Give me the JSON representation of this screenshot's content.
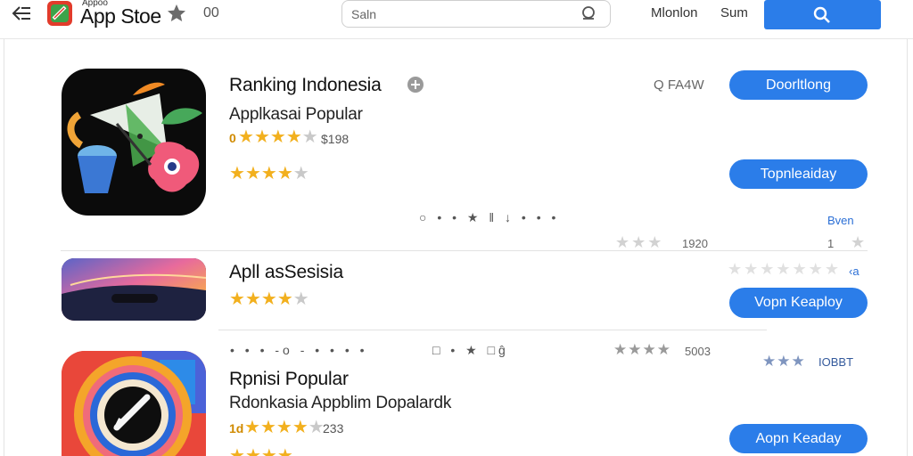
{
  "header": {
    "brand_small": "Appoo",
    "brand": "App Stoe",
    "count": "00",
    "search_placeholder": "Saln",
    "nav_links": [
      "Mlonlon",
      "Sum"
    ]
  },
  "apps": [
    {
      "title": "Ranking Indonesia",
      "subtitle": "Applkasai Popular",
      "rating_prefix": "0",
      "rating_count": "$198",
      "meta": "Q FA4W",
      "buttons": [
        "Doorltlong",
        "Topnleaiday"
      ],
      "dots": "○ • • ★ ǁ ↓ • • •",
      "blue_link": "Bven",
      "faint_count": "1920",
      "star_tail": "1"
    },
    {
      "title": "Apll asSesisia",
      "button": "Vopn Keaploy",
      "faint_tail": "‹a"
    },
    {
      "title": "Rpnisi Popular",
      "subtitle": "Rdonkasia Appblim Dopalardk",
      "rating_prefix": "1d",
      "rating_count": "233",
      "dots_left": "• • • -o - • • • •",
      "dots_mid": "□ • ★ □ĝ",
      "mid_count": "5003",
      "badge": "IOBBT",
      "button": "Aopn Keaday"
    }
  ],
  "colors": {
    "accent": "#2b7de9",
    "star_gold": "#f2b01e",
    "star_gray": "#c9c9c9"
  },
  "icons": [
    "back-icon",
    "store-logo",
    "star-icon",
    "search-icon",
    "plus-icon"
  ]
}
